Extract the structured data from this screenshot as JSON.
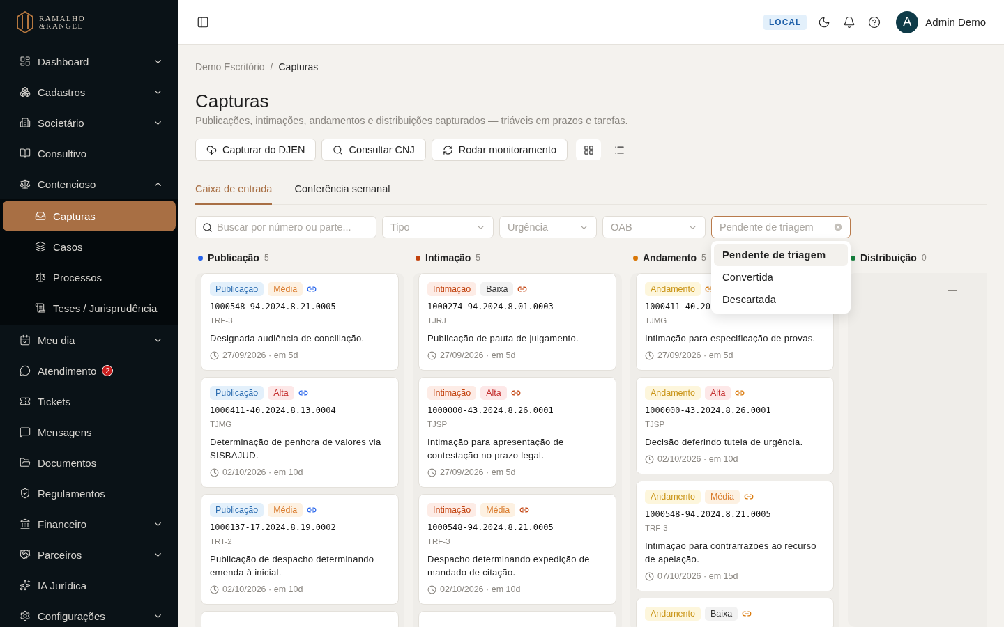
{
  "logo": {
    "lines": [
      "RAMALHO",
      "&RANGEL"
    ]
  },
  "sidebar": {
    "items": [
      {
        "label": "Dashboard",
        "selected": false,
        "expanded": false
      },
      {
        "label": "Cadastros",
        "selected": false,
        "expanded": false
      },
      {
        "label": "Societário",
        "selected": false,
        "expanded": false
      },
      {
        "label": "Consultivo",
        "selected": false
      },
      {
        "label": "Contencioso",
        "selected": false,
        "expanded": true,
        "children": [
          {
            "label": "Capturas",
            "selected": true
          },
          {
            "label": "Casos",
            "selected": false
          },
          {
            "label": "Processos",
            "selected": false
          },
          {
            "label": "Teses / Jurisprudência",
            "selected": false
          }
        ]
      },
      {
        "label": "Meu dia",
        "selected": false,
        "expanded": false
      },
      {
        "label": "Atendimento",
        "selected": false,
        "badge": "2"
      },
      {
        "label": "Tickets",
        "selected": false
      },
      {
        "label": "Mensagens",
        "selected": false
      },
      {
        "label": "Documentos",
        "selected": false
      },
      {
        "label": "Regulamentos",
        "selected": false
      },
      {
        "label": "Financeiro",
        "selected": false,
        "expanded": false
      },
      {
        "label": "Parceiros",
        "selected": false,
        "expanded": false
      },
      {
        "label": "IA Jurídica",
        "selected": false
      },
      {
        "label": "Configurações",
        "selected": false,
        "expanded": false
      }
    ]
  },
  "header": {
    "environment": "LOCAL",
    "avatar_initial": "A",
    "user_name": "Admin Demo"
  },
  "breadcrumb": {
    "separator": "/",
    "items": [
      "Demo Escritório",
      "Capturas"
    ]
  },
  "page": {
    "title": "Capturas",
    "subtitle": "Publicações, intimações, andamentos e distribuições capturados — triáveis em prazos e tarefas."
  },
  "actions": [
    "Capturar do DJEN",
    "Consultar CNJ",
    "Rodar monitoramento"
  ],
  "views": [
    {
      "kind": "grid",
      "selected": true
    },
    {
      "kind": "list",
      "selected": false
    }
  ],
  "tabs": [
    {
      "label": "Caixa de entrada",
      "selected": true
    },
    {
      "label": "Conferência semanal",
      "selected": false
    }
  ],
  "filters": {
    "search": {
      "placeholder": "Buscar por número ou parte..."
    },
    "selects": [
      {
        "placeholder": "Tipo"
      },
      {
        "placeholder": "Urgência"
      },
      {
        "placeholder": "OAB"
      }
    ],
    "status": {
      "value": "Pendente de triagem",
      "open": true,
      "options": [
        {
          "label": "Pendente de triagem",
          "selected": true
        },
        {
          "label": "Convertida",
          "selected": false
        },
        {
          "label": "Descartada",
          "selected": false
        }
      ]
    }
  },
  "columns": [
    {
      "title": "Publicação",
      "count": "5",
      "color": "#2563eb",
      "cards": [
        {
          "kind": "full",
          "tags": [
            {
              "label": "Publicação",
              "kind": "publicacao"
            },
            {
              "label": "Média",
              "kind": "media"
            }
          ],
          "number": "1000548-94.2024.8.21.0005",
          "court": "TRF-3",
          "text": "Designada audiência de conciliação.",
          "date": "27/09/2026",
          "due": "· em 5d"
        },
        {
          "kind": "full",
          "tags": [
            {
              "label": "Publicação",
              "kind": "publicacao"
            },
            {
              "label": "Alta",
              "kind": "alta"
            }
          ],
          "number": "1000411-40.2024.8.13.0004",
          "court": "TJMG",
          "text": "Determinação de penhora de valores via SISBAJUD.",
          "date": "02/10/2026",
          "due": "· em 10d"
        },
        {
          "kind": "full",
          "tags": [
            {
              "label": "Publicação",
              "kind": "publicacao"
            },
            {
              "label": "Média",
              "kind": "media"
            }
          ],
          "number": "1000137-17.2024.8.19.0002",
          "court": "TRT-2",
          "text": "Publicação de despacho determinando emenda à inicial.",
          "date": "02/10/2026",
          "due": "· em 10d"
        },
        {
          "kind": "stub"
        }
      ]
    },
    {
      "title": "Intimação",
      "count": "5",
      "color": "#c2410c",
      "cards": [
        {
          "kind": "full",
          "tags": [
            {
              "label": "Intimação",
              "kind": "intimacao"
            },
            {
              "label": "Baixa",
              "kind": "baixa"
            }
          ],
          "number": "1000274-94.2024.8.01.0003",
          "court": "TJRJ",
          "text": "Publicação de pauta de julgamento.",
          "date": "27/09/2026",
          "due": "· em 5d"
        },
        {
          "kind": "full",
          "tags": [
            {
              "label": "Intimação",
              "kind": "intimacao"
            },
            {
              "label": "Alta",
              "kind": "alta"
            }
          ],
          "number": "1000000-43.2024.8.26.0001",
          "court": "TJSP",
          "text": "Intimação para apresentação de contestação no prazo legal.",
          "date": "27/09/2026",
          "due": "· em 5d"
        },
        {
          "kind": "full",
          "tags": [
            {
              "label": "Intimação",
              "kind": "intimacao"
            },
            {
              "label": "Média",
              "kind": "media"
            }
          ],
          "number": "1000548-94.2024.8.21.0005",
          "court": "TRF-3",
          "text": "Despacho determinando expedição de mandado de citação.",
          "date": "02/10/2026",
          "due": "· em 10d"
        },
        {
          "kind": "stub"
        }
      ]
    },
    {
      "title": "Andamento",
      "count": "5",
      "color": "#d97706",
      "cards": [
        {
          "kind": "full",
          "tags": [
            {
              "label": "Andamento",
              "kind": "andamento"
            }
          ],
          "number": "1000411-40.20",
          "court": "TJMG",
          "text": "Intimação para especificação de provas.",
          "date": "27/09/2026",
          "due": "· em 5d"
        },
        {
          "kind": "full",
          "tags": [
            {
              "label": "Andamento",
              "kind": "andamento"
            },
            {
              "label": "Alta",
              "kind": "alta"
            }
          ],
          "number": "1000000-43.2024.8.26.0001",
          "court": "TJSP",
          "text": "Decisão deferindo tutela de urgência.",
          "date": "02/10/2026",
          "due": "· em 10d"
        },
        {
          "kind": "full",
          "tags": [
            {
              "label": "Andamento",
              "kind": "andamento"
            },
            {
              "label": "Média",
              "kind": "media"
            }
          ],
          "number": "1000548-94.2024.8.21.0005",
          "court": "TRF-3",
          "text": "Intimação para contrarrazões ao recurso de apelação.",
          "date": "07/10/2026",
          "due": "· em 15d"
        },
        {
          "kind": "tags",
          "tags": [
            {
              "label": "Andamento",
              "kind": "andamento"
            },
            {
              "label": "Baixa",
              "kind": "baixa"
            }
          ]
        }
      ]
    },
    {
      "title": "Distribuição",
      "count": "0",
      "color": "#15803d"
    }
  ]
}
